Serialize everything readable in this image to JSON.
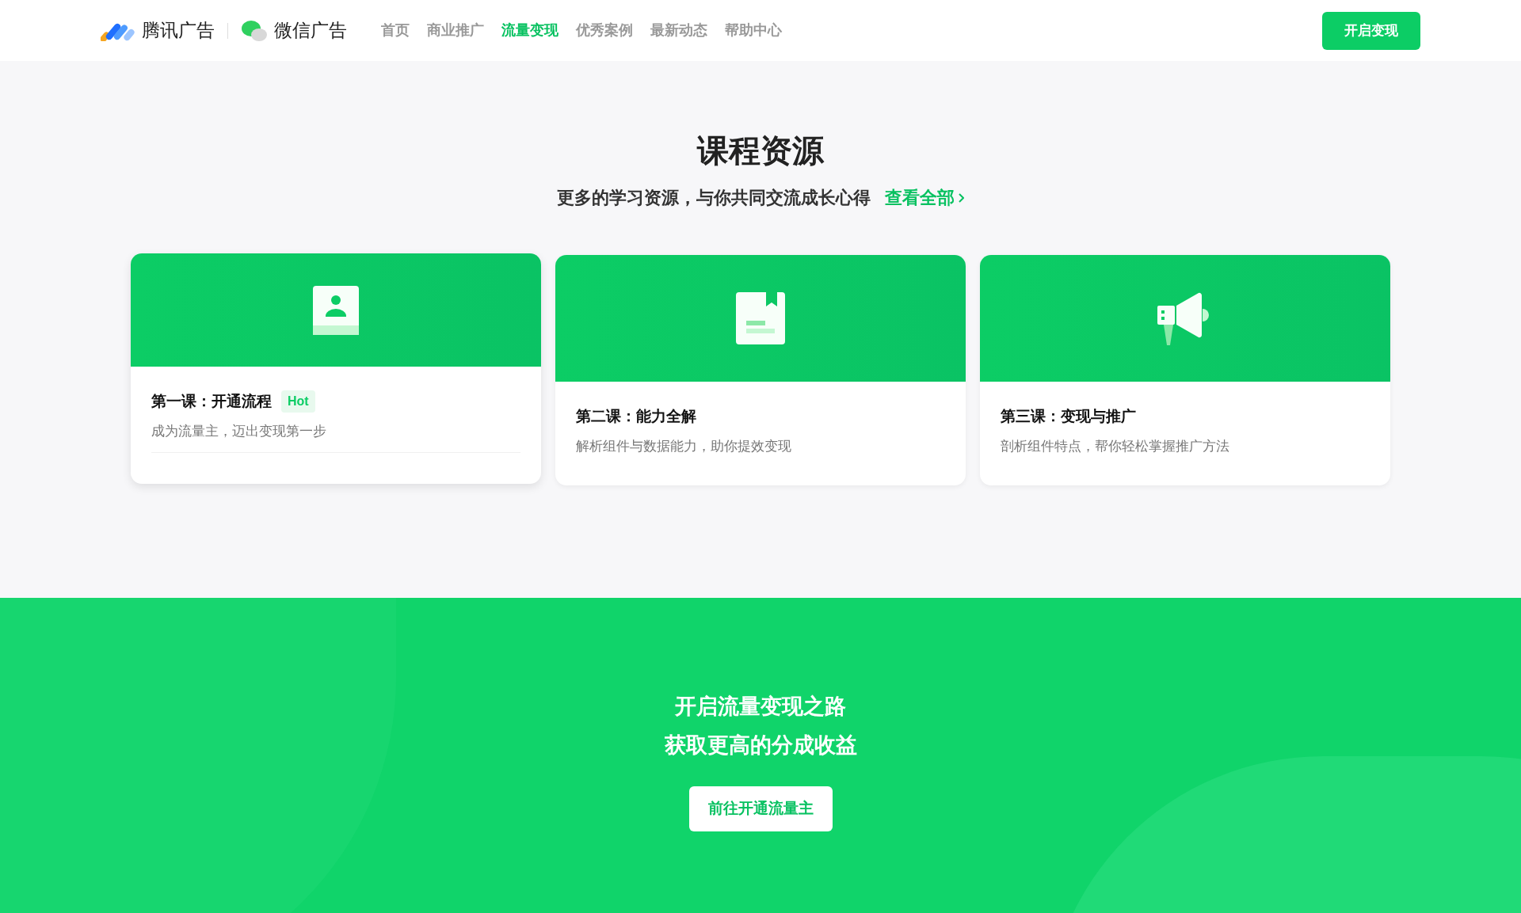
{
  "header": {
    "brand": "腾讯广告",
    "sub_brand": "微信广告",
    "nav": [
      {
        "label": "首页",
        "selected": false
      },
      {
        "label": "商业推广",
        "selected": false
      },
      {
        "label": "流量变现",
        "selected": true
      },
      {
        "label": "优秀案例",
        "selected": false
      },
      {
        "label": "最新动态",
        "selected": false
      },
      {
        "label": "帮助中心",
        "selected": false
      }
    ],
    "cta": "开启变现"
  },
  "courses": {
    "title": "课程资源",
    "subtitle": "更多的学习资源，与你共同交流成长心得",
    "link": "查看全部",
    "cards": [
      {
        "kind": "profile",
        "title": "第一课：开通流程",
        "badge": "Hot",
        "desc": "成为流量主，迈出变现第一步",
        "raised": true
      },
      {
        "kind": "book",
        "title": "第二课：能力全解",
        "desc": "解析组件与数据能力，助你提效变现",
        "raised": false
      },
      {
        "kind": "megaphone",
        "title": "第三课：变现与推广",
        "desc": "剖析组件特点，帮你轻松掌握推广方法",
        "raised": false
      }
    ]
  },
  "banner": {
    "lines": [
      "开启流量变现之路",
      "获取更高的分成收益"
    ],
    "button": "前往开通流量主"
  }
}
